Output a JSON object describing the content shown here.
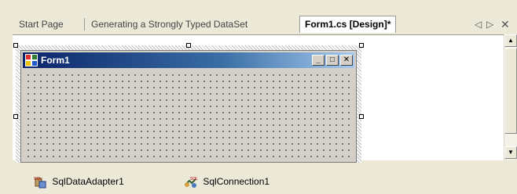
{
  "tabs": [
    {
      "label": "Start Page",
      "active": false
    },
    {
      "label": "Generating a Strongly Typed DataSet",
      "active": false
    },
    {
      "label": "Form1.cs [Design]*",
      "active": true
    }
  ],
  "tab_controls": {
    "prev_icon": "scroll-left-icon",
    "next_icon": "scroll-right-icon",
    "close_icon": "close-icon"
  },
  "form": {
    "title": "Form1",
    "caption_buttons": [
      "minimize",
      "maximize",
      "close"
    ]
  },
  "tray": {
    "items": [
      {
        "label": "SqlDataAdapter1",
        "icon": "sql-data-adapter-icon"
      },
      {
        "label": "SqlConnection1",
        "icon": "sql-connection-icon"
      }
    ]
  },
  "colors": {
    "title_start": "#0A246A",
    "title_end": "#A6CAF0",
    "form_bg": "#D4D0C8",
    "chrome_bg": "#ECE9D8"
  }
}
